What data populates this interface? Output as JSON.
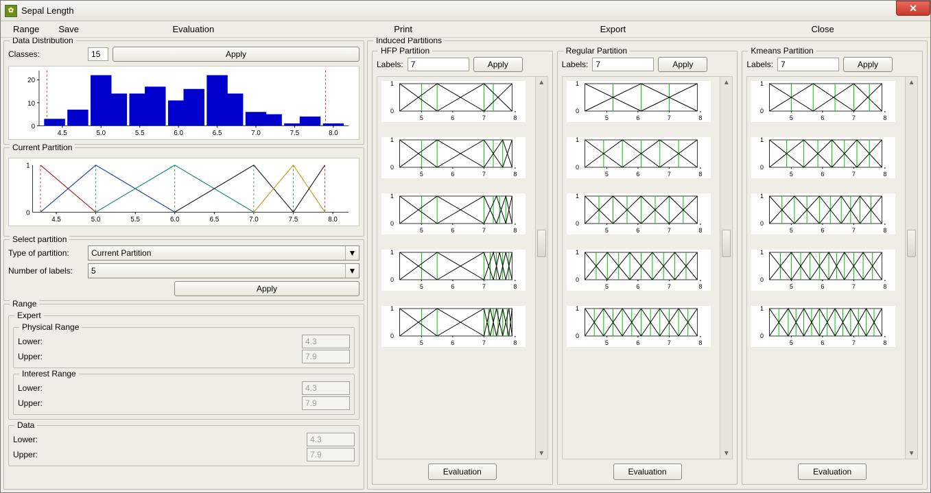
{
  "title": "Sepal Length",
  "menu": {
    "range": "Range",
    "save": "Save",
    "evaluation": "Evaluation",
    "print": "Print",
    "export": "Export",
    "close": "Close"
  },
  "data_dist": {
    "legend": "Data Distribution",
    "classes_label": "Classes:",
    "classes_value": "15",
    "apply": "Apply"
  },
  "current_partition": {
    "legend": "Current Partition"
  },
  "select_partition": {
    "legend": "Select partition",
    "type_label": "Type of partition:",
    "type_value": "Current Partition",
    "num_label": "Number of labels:",
    "num_value": "5",
    "apply": "Apply"
  },
  "range": {
    "legend": "Range",
    "expert": "Expert",
    "physical": "Physical Range",
    "interest": "Interest Range",
    "data": "Data",
    "lower": "Lower:",
    "upper": "Upper:",
    "lower_val": "4.3",
    "upper_val": "7.9"
  },
  "induced": {
    "legend": "Induced Partitions",
    "labels": "Labels:",
    "apply": "Apply",
    "evaluation": "Evaluation",
    "cols": [
      {
        "title": "HFP Partition",
        "value": "7"
      },
      {
        "title": "Regular Partition",
        "value": "7"
      },
      {
        "title": "Kmeans Partition",
        "value": "7"
      }
    ]
  },
  "chart_data": {
    "histogram": {
      "type": "bar",
      "xticks": [
        4.5,
        5.0,
        5.5,
        6.0,
        6.5,
        7.0,
        7.5,
        8.0
      ],
      "yticks": [
        0,
        10,
        20
      ],
      "bar_centers": [
        4.4,
        4.7,
        5.0,
        5.2,
        5.5,
        5.7,
        6.0,
        6.2,
        6.5,
        6.7,
        7.0,
        7.2,
        7.5,
        7.7,
        8.0
      ],
      "values": [
        3,
        7,
        22,
        14,
        14,
        17,
        11,
        16,
        22,
        14,
        6,
        5,
        1,
        4,
        1
      ],
      "xlim": [
        4.2,
        8.2
      ],
      "ylim": [
        0,
        24
      ]
    },
    "current_partition": {
      "type": "fuzzy-triangular",
      "xticks": [
        4.5,
        5.0,
        5.5,
        6.0,
        6.5,
        7.0,
        7.5,
        8.0
      ],
      "yticks": [
        0,
        1
      ],
      "xlim": [
        4.2,
        8.2
      ],
      "ylim": [
        0,
        1
      ],
      "peaks": [
        4.3,
        5.0,
        6.0,
        7.0,
        7.5,
        7.9
      ],
      "colors": [
        "#a02020",
        "#1a3ea0",
        "#1a8a7a",
        "#202020",
        "#c0a020",
        "#202020"
      ],
      "dashed_verticals": [
        4.3,
        5.0,
        6.0,
        7.0,
        7.5,
        7.9
      ]
    },
    "induced_mini": {
      "xticks": [
        5,
        6,
        7,
        8
      ],
      "yticks": [
        0,
        1
      ],
      "xlim": [
        4.2,
        8.2
      ],
      "columns": [
        {
          "name": "HFP",
          "plots": [
            {
              "peaks": [
                4.3,
                5.5,
                7.0,
                7.9
              ],
              "greens": [
                5.0,
                5.5,
                7.0,
                7.3
              ]
            },
            {
              "peaks": [
                4.3,
                5.5,
                7.0,
                7.6,
                7.9
              ],
              "greens": [
                5.0,
                5.5,
                7.0,
                7.3,
                7.6
              ]
            },
            {
              "peaks": [
                4.3,
                5.5,
                7.0,
                7.4,
                7.7,
                7.9
              ],
              "greens": [
                5.0,
                5.5,
                7.0,
                7.3,
                7.5,
                7.7
              ]
            },
            {
              "peaks": [
                4.3,
                5.5,
                7.0,
                7.3,
                7.5,
                7.7,
                7.9
              ],
              "greens": [
                5.0,
                5.5,
                7.0,
                7.2,
                7.4,
                7.6,
                7.8
              ]
            },
            {
              "peaks": [
                4.3,
                5.5,
                7.0,
                7.2,
                7.4,
                7.6,
                7.8,
                7.9
              ],
              "greens": [
                5.0,
                5.5,
                7.0,
                7.15,
                7.3,
                7.45,
                7.6,
                7.75
              ]
            }
          ]
        },
        {
          "name": "Regular",
          "plots": [
            {
              "peaks": [
                4.3,
                6.1,
                7.9
              ],
              "greens": [
                5.2,
                6.1,
                7.0
              ]
            },
            {
              "peaks": [
                4.3,
                5.5,
                6.7,
                7.9
              ],
              "greens": [
                4.9,
                5.5,
                6.1,
                6.7,
                7.3
              ]
            },
            {
              "peaks": [
                4.3,
                5.2,
                6.1,
                7.0,
                7.9
              ],
              "greens": [
                4.75,
                5.2,
                5.65,
                6.1,
                6.55,
                7.0,
                7.45
              ]
            },
            {
              "peaks": [
                4.3,
                5.02,
                5.74,
                6.46,
                7.18,
                7.9
              ],
              "greens": [
                4.66,
                5.02,
                5.38,
                5.74,
                6.1,
                6.46,
                6.82,
                7.18,
                7.54
              ]
            },
            {
              "peaks": [
                4.3,
                4.9,
                5.5,
                6.1,
                6.7,
                7.3,
                7.9
              ],
              "greens": [
                4.6,
                4.9,
                5.2,
                5.5,
                5.8,
                6.1,
                6.4,
                6.7,
                7.0,
                7.3,
                7.6
              ]
            }
          ]
        },
        {
          "name": "Kmeans",
          "plots": [
            {
              "peaks": [
                4.3,
                5.7,
                7.0,
                7.9
              ],
              "greens": [
                5.0,
                5.7,
                6.4,
                7.0,
                7.5
              ]
            },
            {
              "peaks": [
                4.3,
                5.4,
                6.3,
                7.1,
                7.9
              ],
              "greens": [
                4.85,
                5.4,
                5.85,
                6.3,
                6.7,
                7.1,
                7.5
              ]
            },
            {
              "peaks": [
                4.3,
                5.1,
                5.9,
                6.6,
                7.2,
                7.9
              ],
              "greens": [
                4.7,
                5.1,
                5.5,
                5.9,
                6.25,
                6.6,
                6.9,
                7.2,
                7.55
              ]
            },
            {
              "peaks": [
                4.3,
                5.0,
                5.6,
                6.2,
                6.7,
                7.3,
                7.9
              ],
              "greens": [
                4.65,
                5.0,
                5.3,
                5.6,
                5.9,
                6.2,
                6.45,
                6.7,
                7.0,
                7.3,
                7.6
              ]
            },
            {
              "peaks": [
                4.3,
                4.9,
                5.4,
                5.9,
                6.4,
                6.9,
                7.4,
                7.9
              ],
              "greens": [
                4.6,
                4.9,
                5.15,
                5.4,
                5.65,
                5.9,
                6.15,
                6.4,
                6.65,
                6.9,
                7.15,
                7.4,
                7.65
              ]
            }
          ]
        }
      ]
    }
  }
}
